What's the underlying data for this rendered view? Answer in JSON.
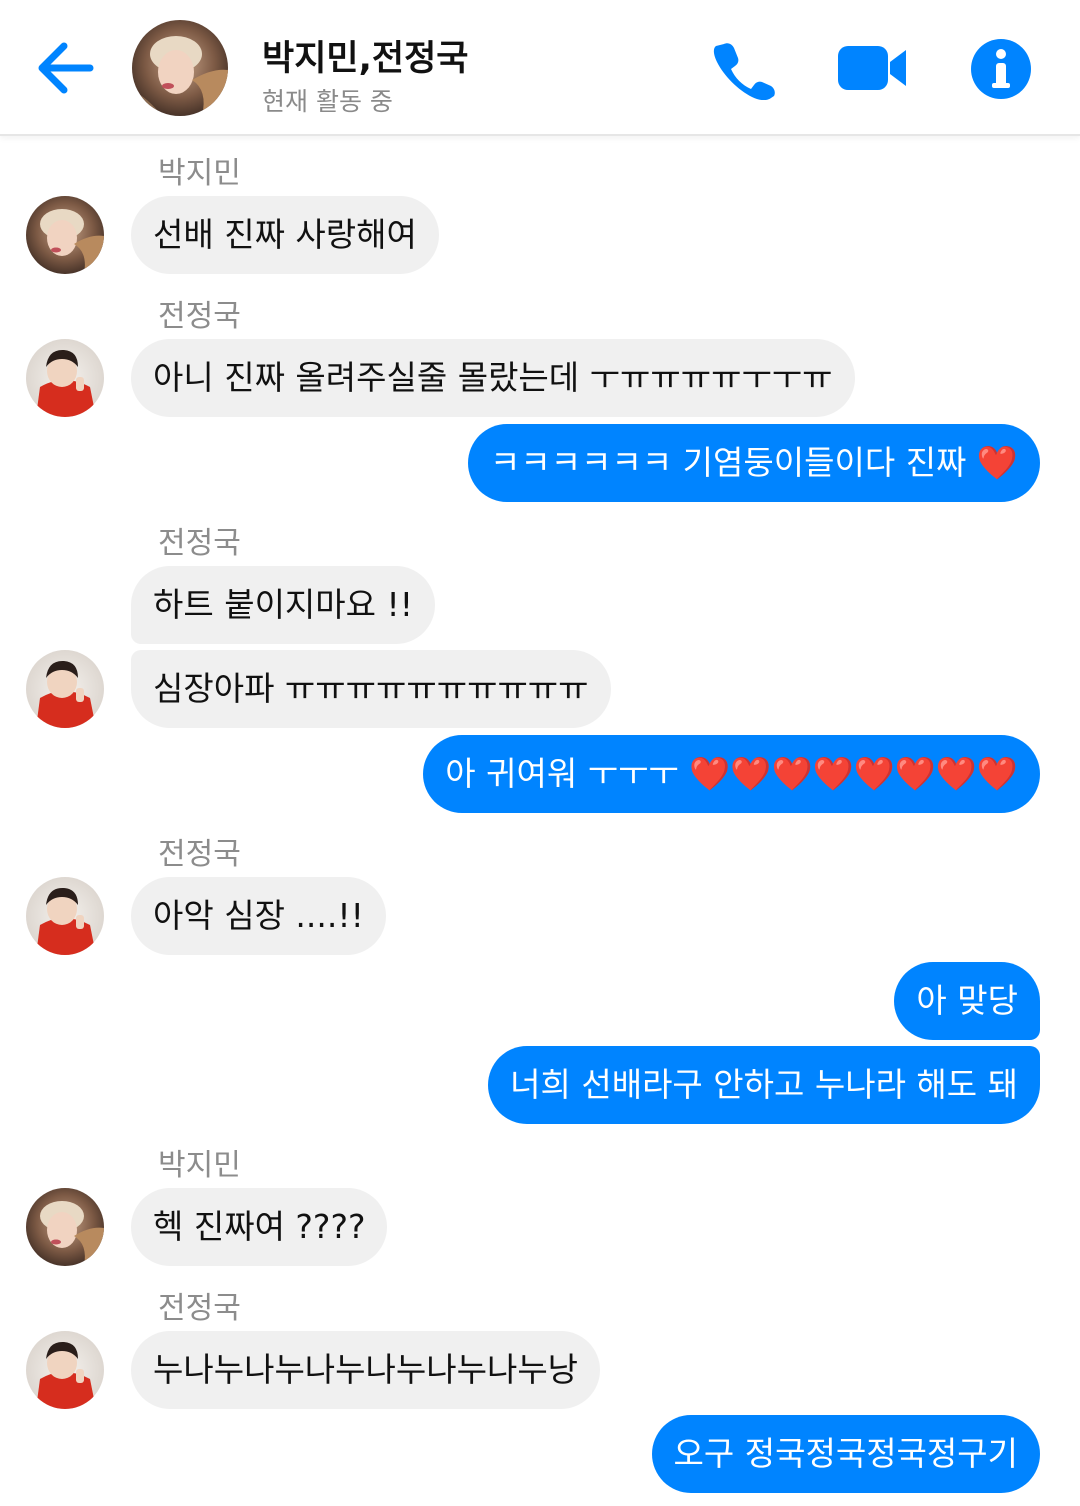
{
  "header": {
    "title": "박지민,전정국",
    "status": "현재 활동 중",
    "back_icon": "back-arrow-icon",
    "phone_icon": "phone-icon",
    "video_icon": "video-camera-icon",
    "info_icon": "info-icon",
    "accent_color": "#0084ff"
  },
  "participants": {
    "jimin": "박지민",
    "jungkook": "전정국"
  },
  "messages": [
    {
      "sender": "박지민",
      "text": "선배 진짜 사랑해여",
      "direction": "incoming"
    },
    {
      "sender": "전정국",
      "text": "아니 진짜 올려주실줄 몰랐는데 ㅜㅠㅠㅠㅠㅜㅜㅠ",
      "direction": "incoming"
    },
    {
      "text": "ㅋㅋㅋㅋㅋㅋ 기염둥이들이다 진짜 ❤️",
      "direction": "outgoing"
    },
    {
      "sender": "전정국",
      "text": "하트 붙이지마요 !!",
      "direction": "incoming"
    },
    {
      "text": "심장아파 ㅠㅠㅠㅠㅠㅠㅠㅠㅠㅠ",
      "direction": "incoming"
    },
    {
      "text": "아 귀여워 ㅜㅜㅜ ❤️❤️❤️❤️❤️❤️❤️❤️",
      "direction": "outgoing"
    },
    {
      "sender": "전정국",
      "text": "아악 심장 ....!!",
      "direction": "incoming"
    },
    {
      "text": "아 맞당",
      "direction": "outgoing"
    },
    {
      "text": "너희 선배라구 안하고 누나라 해도 돼",
      "direction": "outgoing"
    },
    {
      "sender": "박지민",
      "text": "헥 진짜여 ????",
      "direction": "incoming"
    },
    {
      "sender": "전정국",
      "text": "누나누나누나누나누나누나누낭",
      "direction": "incoming"
    },
    {
      "text": "오구 정국정국정국정구기",
      "direction": "outgoing"
    }
  ],
  "colors": {
    "incoming_bubble": "#f0f0f0",
    "outgoing_bubble": "#0084ff",
    "sender_label": "#8c8c8c",
    "status_text": "#8a8a8a"
  }
}
